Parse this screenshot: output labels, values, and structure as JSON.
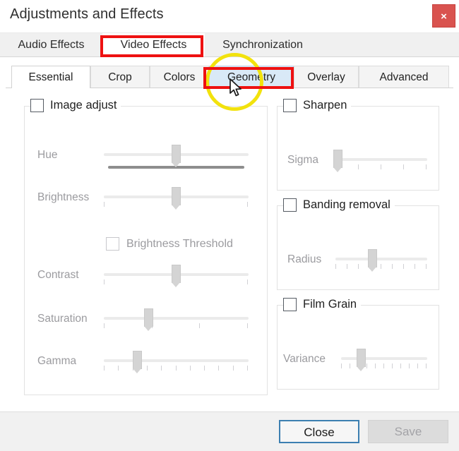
{
  "window": {
    "title": "Adjustments and Effects",
    "close_icon": "close-x-icon",
    "close_label": "×"
  },
  "outer_tabs": {
    "active": "Video Effects",
    "items": [
      {
        "label": "Audio Effects",
        "state": "inactive"
      },
      {
        "label": "Video Effects",
        "state": "active"
      },
      {
        "label": "Synchronization",
        "state": "inactive"
      }
    ]
  },
  "inner_tabs": {
    "active": "Essential",
    "hovered": "Geometry",
    "items": [
      {
        "label": "Essential",
        "state": "active"
      },
      {
        "label": "Crop",
        "state": "normal"
      },
      {
        "label": "Colors",
        "state": "normal"
      },
      {
        "label": "Geometry",
        "state": "hover"
      },
      {
        "label": "Overlay",
        "state": "normal"
      },
      {
        "label": "Advanced",
        "state": "normal"
      }
    ]
  },
  "panels": {
    "image_adjust": {
      "title": "Image adjust",
      "checked": false,
      "sliders": [
        {
          "label": "Hue",
          "value_pct": 50,
          "ticks": 0,
          "has_hue_bar": true
        },
        {
          "label": "Brightness",
          "value_pct": 50,
          "ticks": 3,
          "has_hue_bar": false
        },
        {
          "label": "Contrast",
          "value_pct": 50,
          "ticks": 3,
          "has_hue_bar": false
        },
        {
          "label": "Saturation",
          "value_pct": 31,
          "ticks": 4,
          "has_hue_bar": false
        },
        {
          "label": "Gamma",
          "value_pct": 23,
          "ticks": 11,
          "has_hue_bar": false
        }
      ],
      "sub_checkbox": {
        "label": "Brightness Threshold",
        "checked": false,
        "enabled": false
      }
    },
    "sharpen": {
      "title": "Sharpen",
      "checked": false,
      "sliders": [
        {
          "label": "Sigma",
          "value_pct": 3,
          "ticks": 5
        }
      ]
    },
    "banding_removal": {
      "title": "Banding removal",
      "checked": false,
      "sliders": [
        {
          "label": "Radius",
          "value_pct": 40,
          "ticks": 9
        }
      ]
    },
    "film_grain": {
      "title": "Film Grain",
      "checked": false,
      "sliders": [
        {
          "label": "Variance",
          "value_pct": 23,
          "ticks": 11
        }
      ]
    }
  },
  "footer": {
    "close_label": "Close",
    "save_label": "Save",
    "save_enabled": false
  },
  "annotations": {
    "highlight_color": "#ee1111",
    "circle_color": "#f2e20d",
    "boxes": [
      {
        "target": "Video Effects"
      },
      {
        "target": "Geometry"
      }
    ],
    "circle": {
      "target": "Geometry"
    }
  }
}
